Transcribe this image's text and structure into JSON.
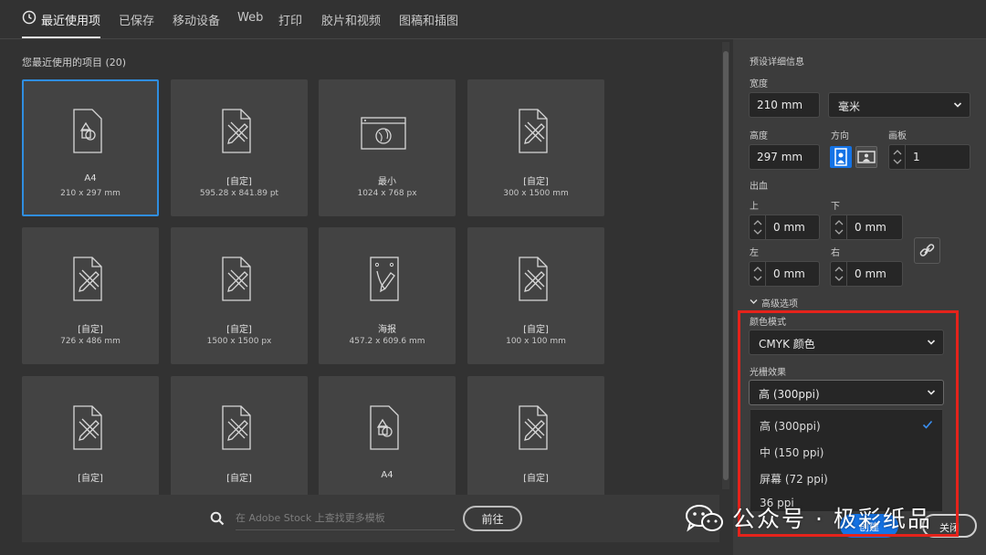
{
  "tabs": [
    {
      "label": "最近使用项"
    },
    {
      "label": "已保存"
    },
    {
      "label": "移动设备"
    },
    {
      "label": "Web"
    },
    {
      "label": "打印"
    },
    {
      "label": "胶片和视频"
    },
    {
      "label": "图稿和插图"
    }
  ],
  "recent": {
    "label": "您最近使用的项目 (20)",
    "items": [
      {
        "name": "A4",
        "size": "210 x 297 mm",
        "icon": "shapes-doc-icon"
      },
      {
        "name": "[自定]",
        "size": "595.28 x 841.89 pt",
        "icon": "pencil-ruler-doc-icon"
      },
      {
        "name": "最小",
        "size": "1024 x 768 px",
        "icon": "web-browser-icon"
      },
      {
        "name": "[自定]",
        "size": "300 x 1500 mm",
        "icon": "pencil-ruler-doc-icon"
      },
      {
        "name": "[自定]",
        "size": "726 x 486 mm",
        "icon": "pencil-ruler-doc-icon"
      },
      {
        "name": "[自定]",
        "size": "1500 x 1500 px",
        "icon": "pencil-ruler-doc-icon"
      },
      {
        "name": "海报",
        "size": "457.2 x 609.6 mm",
        "icon": "poster-pen-icon"
      },
      {
        "name": "[自定]",
        "size": "100 x 100 mm",
        "icon": "pencil-ruler-doc-icon"
      },
      {
        "name": "[自定]",
        "size": "",
        "icon": "pencil-ruler-doc-icon"
      },
      {
        "name": "[自定]",
        "size": "",
        "icon": "pencil-ruler-doc-icon"
      },
      {
        "name": "A4",
        "size": "",
        "icon": "shapes-doc-icon"
      },
      {
        "name": "[自定]",
        "size": "",
        "icon": "pencil-ruler-doc-icon"
      }
    ]
  },
  "search": {
    "placeholder": "在 Adobe Stock 上查找更多模板",
    "go_label": "前往"
  },
  "preset": {
    "title": "预设详细信息",
    "width_label": "宽度",
    "width_value": "210 mm",
    "unit_value": "毫米",
    "height_label": "高度",
    "height_value": "297 mm",
    "orientation_label": "方向",
    "artboards_label": "画板",
    "artboards_value": "1",
    "bleed_label": "出血",
    "top_label": "上",
    "top_value": "0 mm",
    "bottom_label": "下",
    "bottom_value": "0 mm",
    "left_label": "左",
    "left_value": "0 mm",
    "right_label": "右",
    "right_value": "0 mm",
    "advanced_label": "高级选项",
    "color_mode_label": "颜色模式",
    "color_mode_value": "CMYK 颜色",
    "raster_label": "光栅效果",
    "raster_value": "高 (300ppi)",
    "raster_options": [
      "高 (300ppi)",
      "中 (150 ppi)",
      "屏幕 (72 ppi)",
      "36 ppi"
    ]
  },
  "buttons": {
    "create": "创建",
    "close": "关闭"
  },
  "watermark": {
    "text": "公众号 · 极彩纸品"
  },
  "colors": {
    "accent": "#1473e6",
    "highlight": "#e5231b",
    "selection": "#2f8ee0"
  }
}
